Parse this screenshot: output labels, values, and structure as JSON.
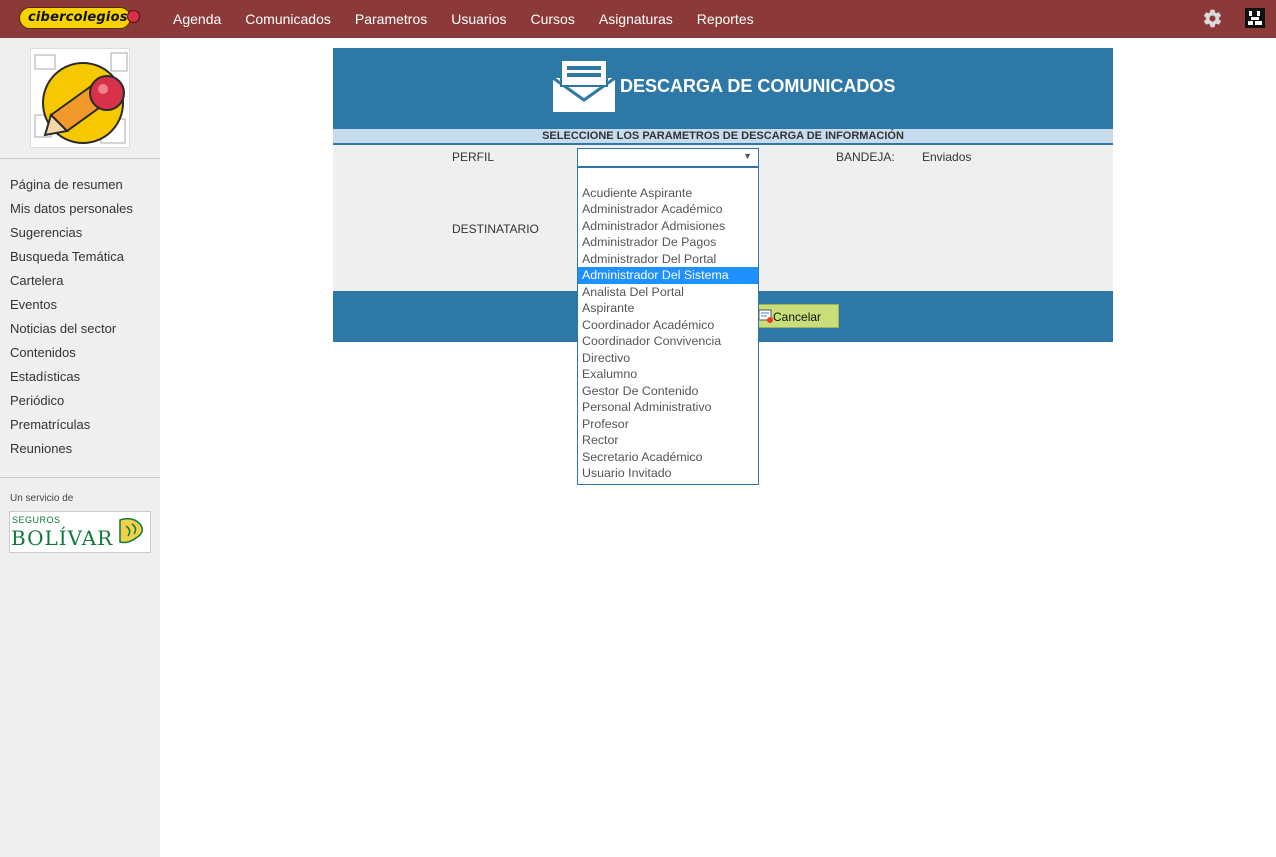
{
  "app": {
    "logo_text": "cibercolegios"
  },
  "nav": {
    "items": [
      "Agenda",
      "Comunicados",
      "Parametros",
      "Usuarios",
      "Cursos",
      "Asignaturas",
      "Reportes"
    ]
  },
  "sidebar": {
    "items": [
      "Página de resumen",
      "Mis datos personales",
      "Sugerencias",
      "Busqueda Temática",
      "Cartelera",
      "Eventos",
      "Noticias del sector",
      "Contenidos",
      "Estadísticas",
      "Periódico",
      "Prematrículas",
      "Reuniones"
    ],
    "service_label": "Un servicio de",
    "partner_small": "SEGUROS",
    "partner_big": "BOLÍVAR"
  },
  "panel": {
    "title": "DESCARGA DE COMUNICADOS",
    "subtitle": "SELECCIONE LOS PARAMETROS DE DESCARGA DE INFORMACIÓN",
    "perfil_label": "PERFIL",
    "perfil_value": "",
    "bandeja_label": "BANDEJA:",
    "bandeja_value": "Enviados",
    "destinatario_label": "DESTINATARIO",
    "cancel_label": "Cancelar"
  },
  "dropdown": {
    "selected_index": 6,
    "options": [
      "",
      "Acudiente Aspirante",
      "Administrador Académico",
      "Administrador Admisiones",
      "Administrador De Pagos",
      "Administrador Del Portal",
      "Administrador Del Sistema",
      "Analista Del Portal",
      "Aspirante",
      "Coordinador Académico",
      "Coordinador Convivencia",
      "Directivo",
      "Exalumno",
      "Gestor De Contenido",
      "Personal Administrativo",
      "Profesor",
      "Rector",
      "Secretario Académico",
      "Usuario Invitado"
    ]
  },
  "colors": {
    "topbar": "#8b3a39",
    "panel_blue": "#2e78a8",
    "highlight": "#1e90ff",
    "button": "#c9dd7a"
  }
}
